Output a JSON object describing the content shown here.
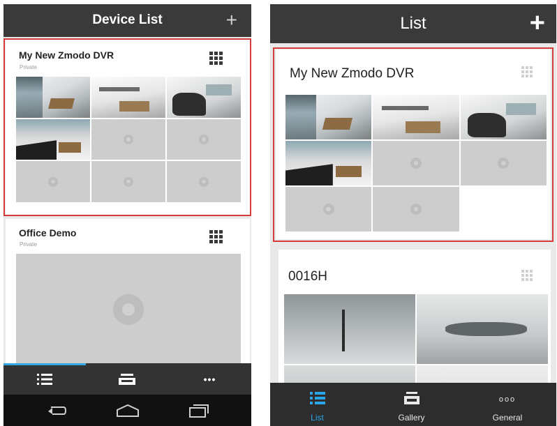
{
  "left_screen": {
    "header": {
      "title": "Device List",
      "add_label": "+"
    },
    "devices": [
      {
        "name": "My New Zmodo DVR",
        "subtitle": "Private"
      },
      {
        "name": "Office Demo",
        "subtitle": "Private"
      }
    ],
    "bottom_nav": {
      "more_label": "•••"
    }
  },
  "right_screen": {
    "header": {
      "title": "List",
      "add_label": "+"
    },
    "devices": [
      {
        "name": "My New Zmodo DVR"
      },
      {
        "name": "0016H"
      }
    ],
    "bottom_nav": {
      "tabs": [
        {
          "label": "List"
        },
        {
          "label": "Gallery"
        },
        {
          "label": "General"
        }
      ],
      "general_dots": "ooo"
    }
  },
  "colors": {
    "header_bg": "#3a3a3a",
    "highlight_border": "#d63b3b",
    "active_tab_accent": "#2ba6e8",
    "nav_bg": "#2d2d2d"
  },
  "icons": {
    "header_add": "plus-icon",
    "card_menu": "grid-menu-icon",
    "empty_channel": "camera-placeholder-icon",
    "nav_list": "list-icon",
    "nav_gallery": "gallery-tray-icon",
    "nav_more": "more-dots-icon",
    "sys_back": "back-icon",
    "sys_home": "home-icon",
    "sys_recents": "recents-icon"
  }
}
